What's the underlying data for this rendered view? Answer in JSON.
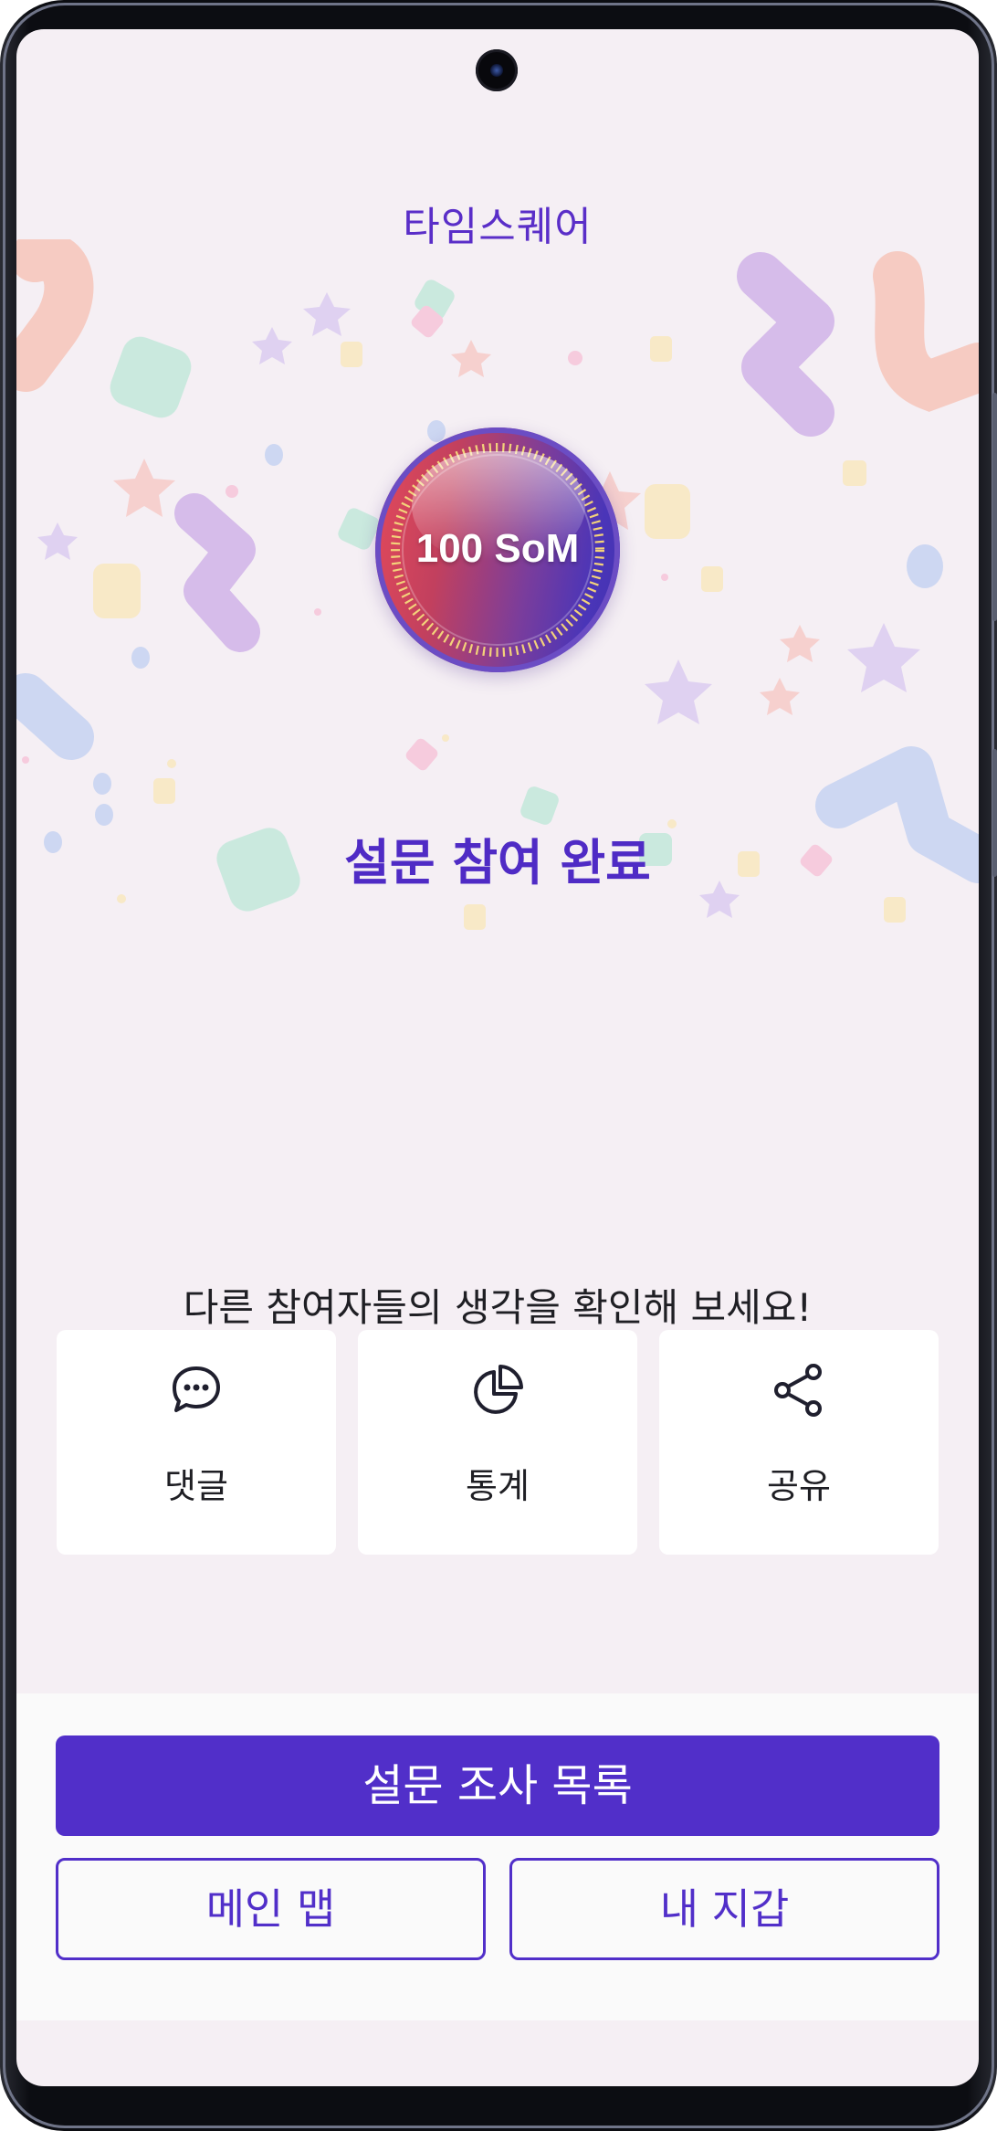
{
  "app": {
    "title": "타임스퀘어"
  },
  "reward": {
    "amount_label": "100 SoM"
  },
  "status": {
    "title": "설문 참여 완료"
  },
  "prompt": "다른 참여자들의 생각을 확인해 보세요!",
  "actions": [
    {
      "label": "댓글",
      "icon": "comment-icon"
    },
    {
      "label": "통계",
      "icon": "pie-chart-icon"
    },
    {
      "label": "공유",
      "icon": "share-icon"
    }
  ],
  "buttons": {
    "survey_list": "설문 조사 목록",
    "main_map": "메인 맵",
    "my_wallet": "내 지갑"
  },
  "colors": {
    "accent": "#512fc9",
    "background": "#f5eff4",
    "text": "#1f1f24"
  }
}
